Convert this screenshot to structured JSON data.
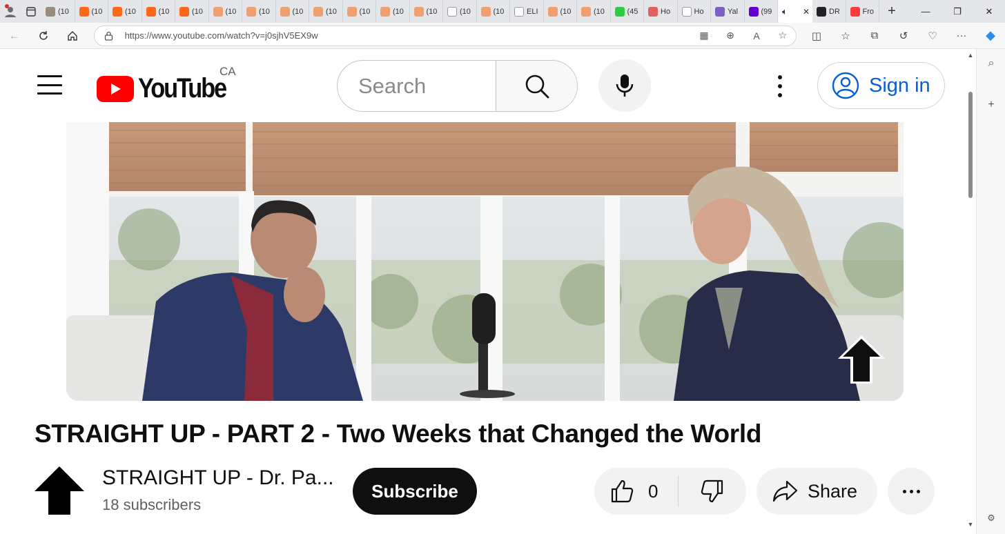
{
  "browser": {
    "tabs": [
      {
        "label": "(10",
        "icon": "image-favicon",
        "color": "#9a8c7a"
      },
      {
        "label": "(10",
        "icon": "substack-favicon",
        "color": "#ff6719"
      },
      {
        "label": "(10",
        "icon": "substack-favicon",
        "color": "#ff6719"
      },
      {
        "label": "(10",
        "icon": "substack-favicon",
        "color": "#ff6719"
      },
      {
        "label": "(10",
        "icon": "substack-favicon",
        "color": "#ff6719"
      },
      {
        "label": "(10",
        "icon": "substack-favicon",
        "color": "#f0a070"
      },
      {
        "label": "(10",
        "icon": "substack-favicon",
        "color": "#f0a070"
      },
      {
        "label": "(10",
        "icon": "substack-favicon",
        "color": "#f0a070"
      },
      {
        "label": "(10",
        "icon": "substack-favicon",
        "color": "#f0a070"
      },
      {
        "label": "(10",
        "icon": "substack-favicon",
        "color": "#f0a070"
      },
      {
        "label": "(10",
        "icon": "substack-favicon",
        "color": "#f0a070"
      },
      {
        "label": "(10",
        "icon": "substack-favicon",
        "color": "#f0a070"
      },
      {
        "label": "(10",
        "icon": "page-favicon",
        "color": "#ffffff"
      },
      {
        "label": "(10",
        "icon": "substack-favicon",
        "color": "#f0a070"
      },
      {
        "label": "ELI",
        "icon": "page-favicon",
        "color": "#ffffff"
      },
      {
        "label": "(10",
        "icon": "substack-favicon",
        "color": "#f0a070"
      },
      {
        "label": "(10",
        "icon": "substack-favicon",
        "color": "#f0a070"
      },
      {
        "label": "(45",
        "icon": "g-favicon",
        "color": "#2ecc40"
      },
      {
        "label": "Ho",
        "icon": "red-favicon",
        "color": "#e06060"
      },
      {
        "label": "Ho",
        "icon": "page-favicon",
        "color": "#ffffff"
      },
      {
        "label": "Yal",
        "icon": "yahoo-favicon",
        "color": "#7b5fc7"
      },
      {
        "label": "(99",
        "icon": "mail-favicon",
        "color": "#6001d2"
      }
    ],
    "active_tab": {
      "icon": "speaker-icon",
      "close": "✕"
    },
    "after_tabs": [
      {
        "label": "DR",
        "icon": "dr-favicon",
        "color": "#222222"
      },
      {
        "label": "Fro",
        "icon": "youtube-favicon",
        "color": "#ff3b3b"
      }
    ],
    "new_tab": "+",
    "window_controls": {
      "minimize": "—",
      "restore": "❐",
      "close": "✕"
    },
    "url": "https://www.youtube.com/watch?v=j0sjhV5EX9w"
  },
  "youtube": {
    "logo_text": "YouTube",
    "region": "CA",
    "search_placeholder": "Search",
    "sign_in": "Sign in",
    "brand_color": "#ff0000",
    "link_color": "#065fd4"
  },
  "video": {
    "title": "STRAIGHT UP - PART 2 - Two Weeks that Changed the World",
    "channel_name": "STRAIGHT UP - Dr. Pa...",
    "subscribers": "18 subscribers",
    "subscribe_label": "Subscribe",
    "like_count": "0",
    "share_label": "Share"
  }
}
